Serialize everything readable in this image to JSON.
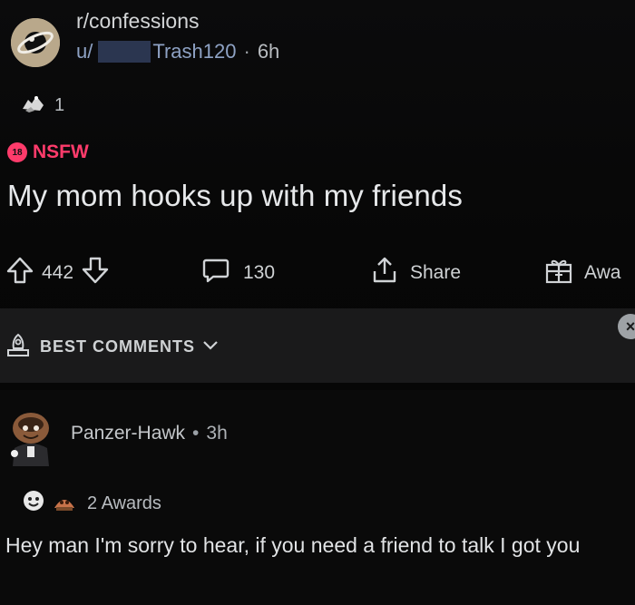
{
  "post": {
    "subreddit": "r/confessions",
    "author_prefix": "u/",
    "author_suffix": "Trash120",
    "age": "6h",
    "award_count": "1",
    "nsfw_label": "NSFW",
    "nsfw_badge": "18",
    "title": "My mom hooks up with my friends"
  },
  "actions": {
    "upvotes": "442",
    "comments": "130",
    "share_label": "Share",
    "award_label": "Awa"
  },
  "sort": {
    "label": "BEST COMMENTS"
  },
  "comment": {
    "author": "PanzerHawk",
    "author_display": "Panzer-Hawk",
    "separator": "•",
    "age": "3h",
    "awards_label": "2 Awards",
    "text": "Hey man I'm sorry to hear, if you need a friend to talk I got you"
  },
  "colors": {
    "nsfw": "#ff3b6b",
    "author_link": "#8ea2c4",
    "background": "#050505",
    "sort_bar": "#1a1a1b"
  },
  "icons": {
    "subreddit": "planet-icon",
    "post_award": "award-icon",
    "upvote": "upvote-arrow-icon",
    "downvote": "downvote-arrow-icon",
    "comment": "comment-bubble-icon",
    "share": "share-icon",
    "give_award": "gift-icon",
    "sort": "rocket-badge-icon",
    "close": "close-icon"
  }
}
